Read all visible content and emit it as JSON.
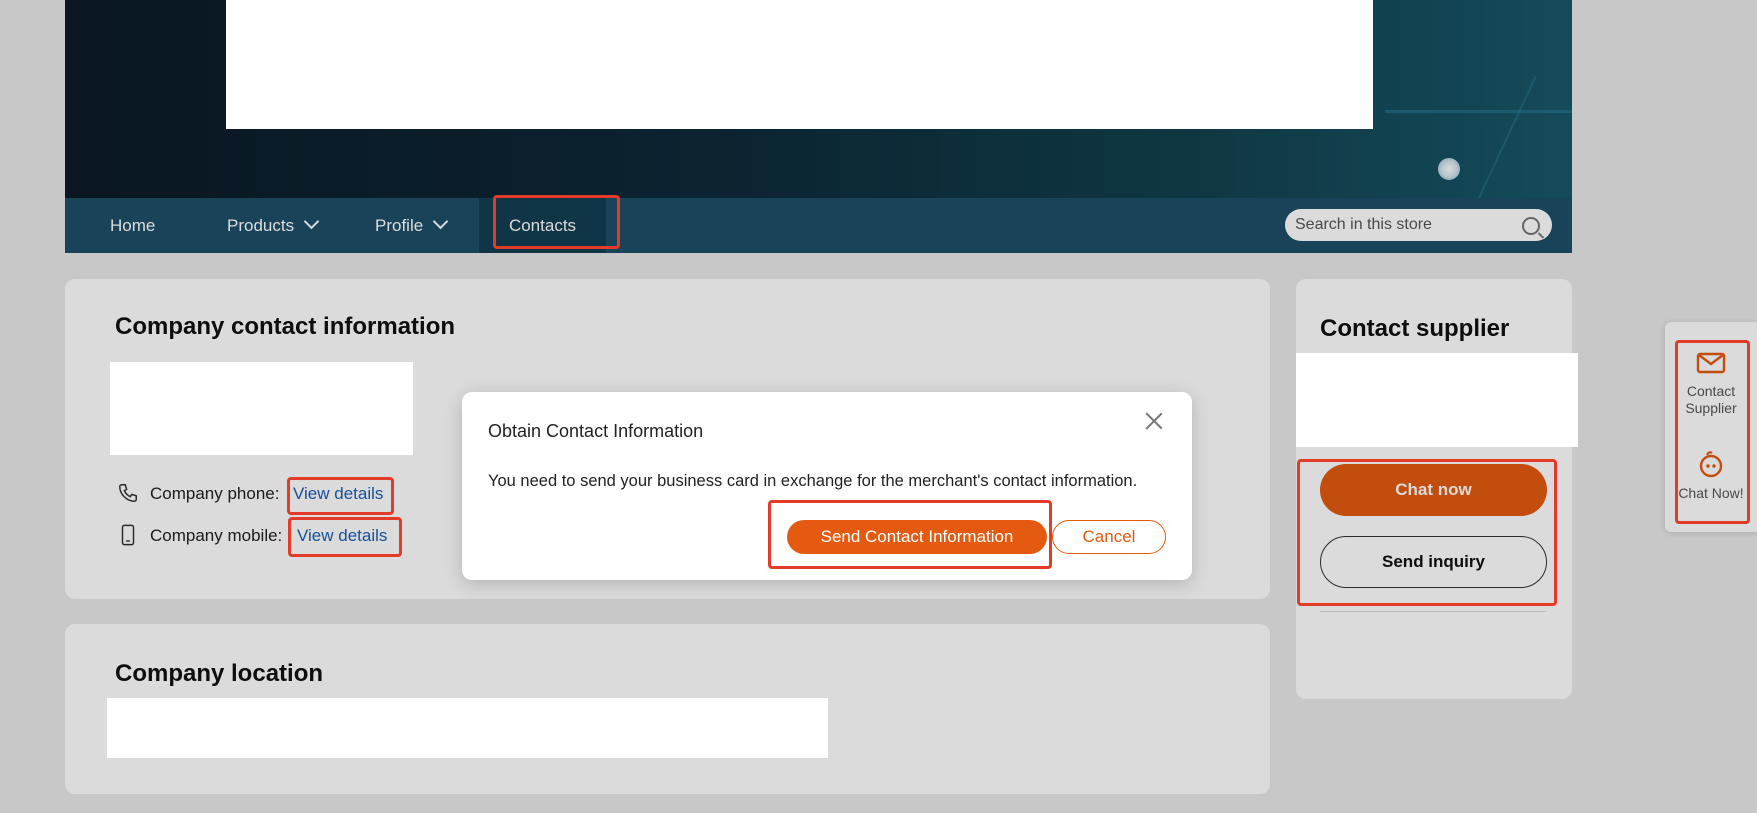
{
  "nav": {
    "items": [
      {
        "label": "Home"
      },
      {
        "label": "Products"
      },
      {
        "label": "Profile"
      },
      {
        "label": "Contacts"
      }
    ],
    "search_placeholder": "Search in this store",
    "search_icon": "search-icon"
  },
  "contact_info": {
    "title": "Company contact information",
    "phone_label": "Company phone:",
    "phone_link": "View details",
    "mobile_label": "Company mobile:",
    "mobile_link": "View details",
    "phone_icon": "phone-icon",
    "mobile_icon": "mobile-icon"
  },
  "location": {
    "title": "Company location"
  },
  "supplier": {
    "title": "Contact supplier",
    "chat_button": "Chat now",
    "inquiry_button": "Send inquiry"
  },
  "dialog": {
    "title": "Obtain Contact Information",
    "message": "You need to send your business card in exchange for the merchant's contact information.",
    "send_button": "Send Contact Information",
    "cancel_button": "Cancel"
  },
  "side_panel": {
    "contact_label": "Contact Supplier",
    "chat_label": "Chat Now!",
    "contact_icon": "mail-icon",
    "chat_icon": "chat-face-icon"
  },
  "colors": {
    "accent": "#e35a10",
    "nav_bg": "#1d4f67",
    "link": "#1a5fb4",
    "highlight": "#e23b28"
  }
}
